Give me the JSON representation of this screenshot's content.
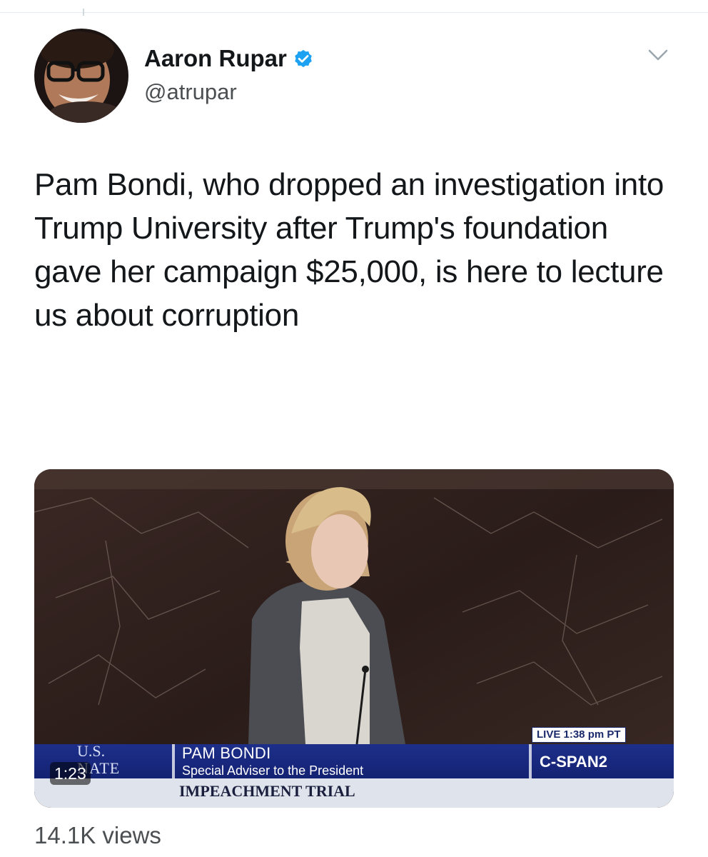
{
  "author": {
    "name": "Aaron Rupar",
    "handle": "@atrupar",
    "verified": true,
    "avatar_icon": "avatar-photo"
  },
  "tweet": {
    "text": "Pam Bondi, who dropped an investigation into Trump University after Trump's foundation gave her campaign $25,000, is here to lecture us about corruption"
  },
  "video": {
    "timer": "1:23",
    "overlay": {
      "live_label": "LIVE  1:38 pm PT",
      "logo_line1": "U.S.",
      "logo_line2": "NATE",
      "speaker_name": "PAM BONDI",
      "speaker_title": "Special Adviser to the President",
      "network": "C-SPAN2",
      "program": "IMPEACHMENT TRIAL"
    }
  },
  "stats": {
    "views": "14.1K views"
  },
  "icons": {
    "verified": "verified-badge-icon",
    "more": "chevron-down-icon"
  },
  "colors": {
    "verified_blue": "#1da1f2",
    "text": "#14171a",
    "secondary_text": "#4b4f52",
    "cspan_blue": "#1d2f8a"
  }
}
